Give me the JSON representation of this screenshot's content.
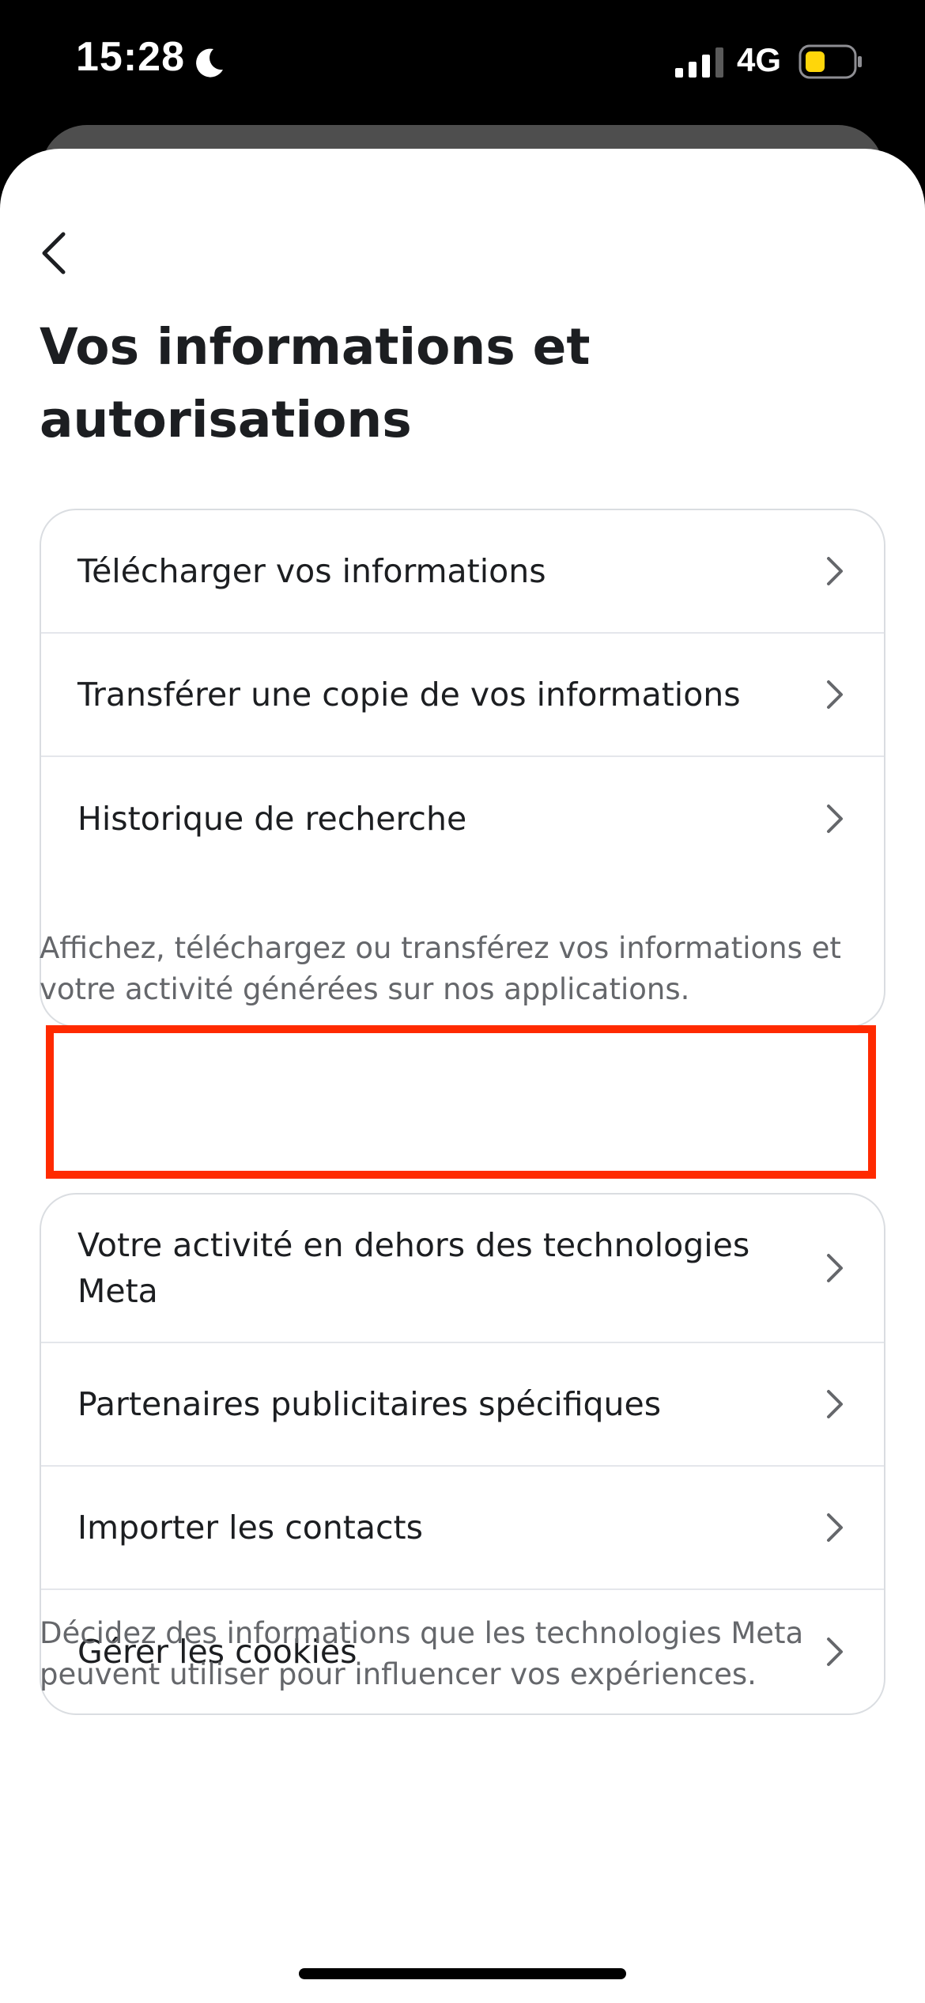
{
  "status_bar": {
    "time": "15:28",
    "network": "4G",
    "icons": {
      "moon": "moon-icon",
      "signal": "signal-icon",
      "battery": "battery-icon"
    },
    "battery_color": "#ffd60a"
  },
  "header": {
    "back_icon": "chevron-left-icon",
    "title": "Vos informations et autorisations"
  },
  "groups": [
    {
      "items": [
        {
          "label": "Télécharger vos informations",
          "icon": "chevron-right-icon"
        },
        {
          "label": "Transférer une copie de vos informations",
          "icon": "chevron-right-icon"
        },
        {
          "label": "Historique de recherche",
          "icon": "chevron-right-icon"
        }
      ],
      "caption": "Affichez, téléchargez ou transférez vos informations et votre activité générées sur nos applications."
    },
    {
      "items": [
        {
          "label": "Votre activité en dehors des technologies Meta",
          "icon": "chevron-right-icon",
          "highlighted": true
        },
        {
          "label": "Partenaires publicitaires spécifiques",
          "icon": "chevron-right-icon"
        },
        {
          "label": "Importer les contacts",
          "icon": "chevron-right-icon"
        },
        {
          "label": "Gérer les cookies",
          "icon": "chevron-right-icon"
        }
      ],
      "caption": "Décidez des informations que les technologies Meta peuvent utiliser pour influencer vos expériences."
    }
  ],
  "colors": {
    "highlight": "#ff2a00",
    "text_primary": "#1c1e21",
    "text_secondary": "#65676b",
    "border": "#dadde1"
  }
}
